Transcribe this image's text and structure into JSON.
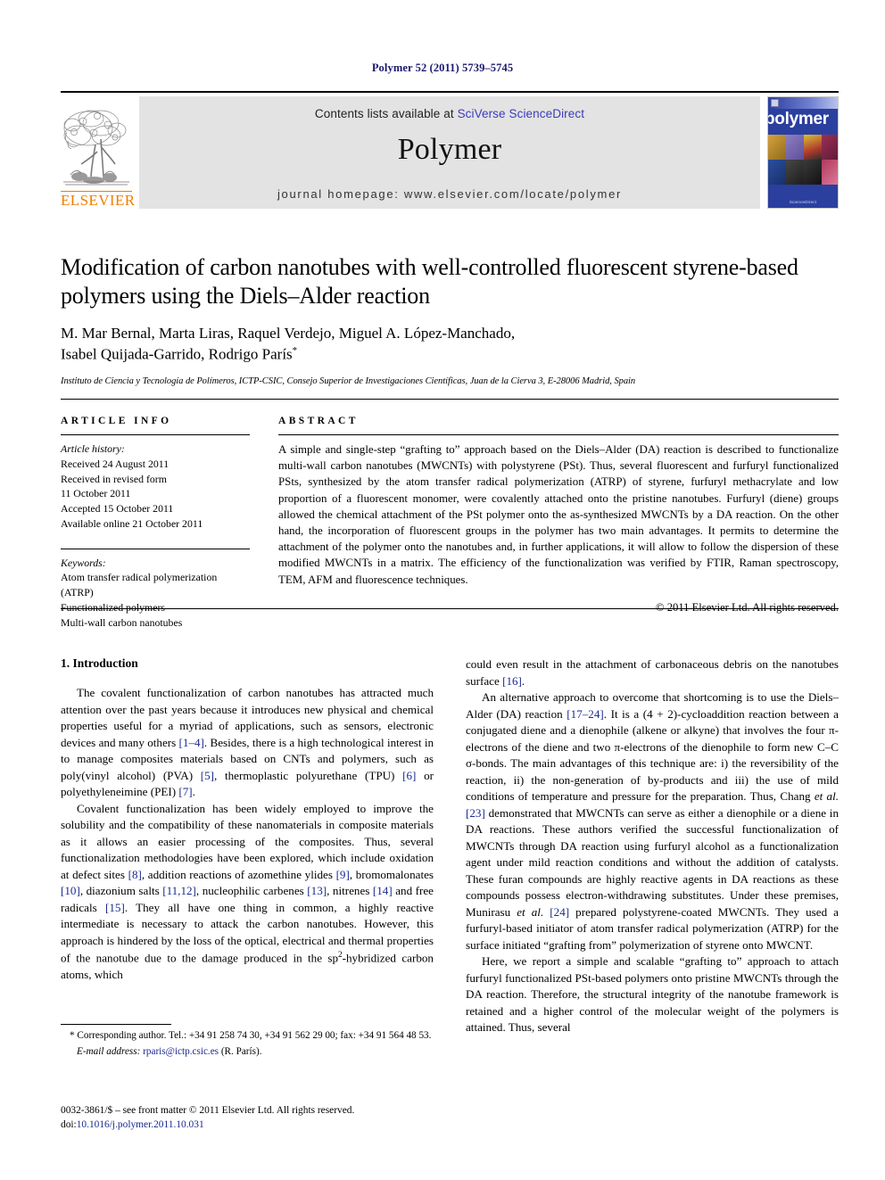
{
  "running_head": "Polymer 52 (2011) 5739–5745",
  "header": {
    "contents_prefix": "Contents lists available at ",
    "contents_link": "SciVerse ScienceDirect",
    "journal_name": "Polymer",
    "homepage": "journal homepage: www.elsevier.com/locate/polymer",
    "publisher_name": "ELSEVIER",
    "cover_title": "polymer",
    "cover_footer": "ScienceDirect",
    "accent_orange": "#ef7d00",
    "link_blue": "#3b3bbf",
    "band_grey": "#e3e3e3",
    "cover_blue": "#2b3f9e"
  },
  "article": {
    "title": "Modification of carbon nanotubes with well-controlled fluorescent styrene-based polymers using the Diels–Alder reaction",
    "authors_line1": "M. Mar Bernal, Marta Liras, Raquel Verdejo, Miguel A. López-Manchado,",
    "authors_line2": "Isabel Quijada-Garrido, Rodrigo París",
    "corresponding_marker": "*",
    "affiliation": "Instituto de Ciencia y Tecnología de Polímeros, ICTP-CSIC, Consejo Superior de Investigaciones Científicas, Juan de la Cierva 3, E-28006 Madrid, Spain"
  },
  "article_info": {
    "heading": "ARTICLE INFO",
    "history_label": "Article history:",
    "history": [
      "Received 24 August 2011",
      "Received in revised form",
      "11 October 2011",
      "Accepted 15 October 2011",
      "Available online 21 October 2011"
    ],
    "keywords_label": "Keywords:",
    "keywords": [
      "Atom transfer radical polymerization (ATRP)",
      "Functionalized polymers",
      "Multi-wall carbon nanotubes"
    ]
  },
  "abstract": {
    "heading": "ABSTRACT",
    "text": "A simple and single-step “grafting to” approach based on the Diels–Alder (DA) reaction is described to functionalize multi-wall carbon nanotubes (MWCNTs) with polystyrene (PSt). Thus, several fluorescent and furfuryl functionalized PSts, synthesized by the atom transfer radical polymerization (ATRP) of styrene, furfuryl methacrylate and low proportion of a fluorescent monomer, were covalently attached onto the pristine nanotubes. Furfuryl (diene) groups allowed the chemical attachment of the PSt polymer onto the as-synthesized MWCNTs by a DA reaction. On the other hand, the incorporation of fluorescent groups in the polymer has two main advantages. It permits to determine the attachment of the polymer onto the nanotubes and, in further applications, it will allow to follow the dispersion of these modified MWCNTs in a matrix. The efficiency of the functionalization was verified by FTIR, Raman spectroscopy, TEM, AFM and fluorescence techniques.",
    "copyright": "© 2011 Elsevier Ltd. All rights reserved."
  },
  "introduction": {
    "heading": "1. Introduction",
    "left_paragraphs": [
      "The covalent functionalization of carbon nanotubes has attracted much attention over the past years because it introduces new physical and chemical properties useful for a myriad of applications, such as sensors, electronic devices and many others [1–4]. Besides, there is a high technological interest in to manage composites materials based on CNTs and polymers, such as poly(vinyl alcohol) (PVA) [5], thermoplastic polyurethane (TPU) [6] or polyethyleneimine (PEI) [7].",
      "Covalent functionalization has been widely employed to improve the solubility and the compatibility of these nanomaterials in composite materials as it allows an easier processing of the composites. Thus, several functionalization methodologies have been explored, which include oxidation at defect sites [8], addition reactions of azomethine ylides [9], bromomalonates [10], diazonium salts [11,12], nucleophilic carbenes [13], nitrenes [14] and free radicals [15]. They all have one thing in common, a highly reactive intermediate is necessary to attack the carbon nanotubes. However, this approach is hindered by the loss of the optical, electrical and thermal properties of the nanotube due to the damage produced in the sp2-hybridized carbon atoms, which"
    ],
    "right_paragraphs": [
      "could even result in the attachment of carbonaceous debris on the nanotubes surface [16].",
      "An alternative approach to overcome that shortcoming is to use the Diels–Alder (DA) reaction [17–24]. It is a (4 + 2)-cycloaddition reaction between a conjugated diene and a dienophile (alkene or alkyne) that involves the four π-electrons of the diene and two π-electrons of the dienophile to form new C–C σ-bonds. The main advantages of this technique are: i) the reversibility of the reaction, ii) the non-generation of by-products and iii) the use of mild conditions of temperature and pressure for the preparation. Thus, Chang et al. [23] demonstrated that MWCNTs can serve as either a dienophile or a diene in DA reactions. These authors verified the successful functionalization of MWCNTs through DA reaction using furfuryl alcohol as a functionalization agent under mild reaction conditions and without the addition of catalysts. These furan compounds are highly reactive agents in DA reactions as these compounds possess electron-withdrawing substitutes. Under these premises, Munirasu et al. [24] prepared polystyrene-coated MWCNTs. They used a furfuryl-based initiator of atom transfer radical polymerization (ATRP) for the surface initiated “grafting from” polymerization of styrene onto MWCNT.",
      "Here, we report a simple and scalable “grafting to” approach to attach furfuryl functionalized PSt-based polymers onto pristine MWCNTs through the DA reaction. Therefore, the structural integrity of the nanotube framework is retained and a higher control of the molecular weight of the polymers is attained. Thus, several"
    ]
  },
  "footnotes": {
    "corresponding": "* Corresponding author. Tel.: +34 91 258 74 30, +34 91 562 29 00; fax: +34 91 564 48 53.",
    "email_label": "E-mail address:",
    "email_address": "rparis@ictp.csic.es",
    "email_owner": "(R. París)."
  },
  "imprint": {
    "line1": "0032-3861/$ – see front matter © 2011 Elsevier Ltd. All rights reserved.",
    "doi_prefix": "doi:",
    "doi": "10.1016/j.polymer.2011.10.031"
  }
}
